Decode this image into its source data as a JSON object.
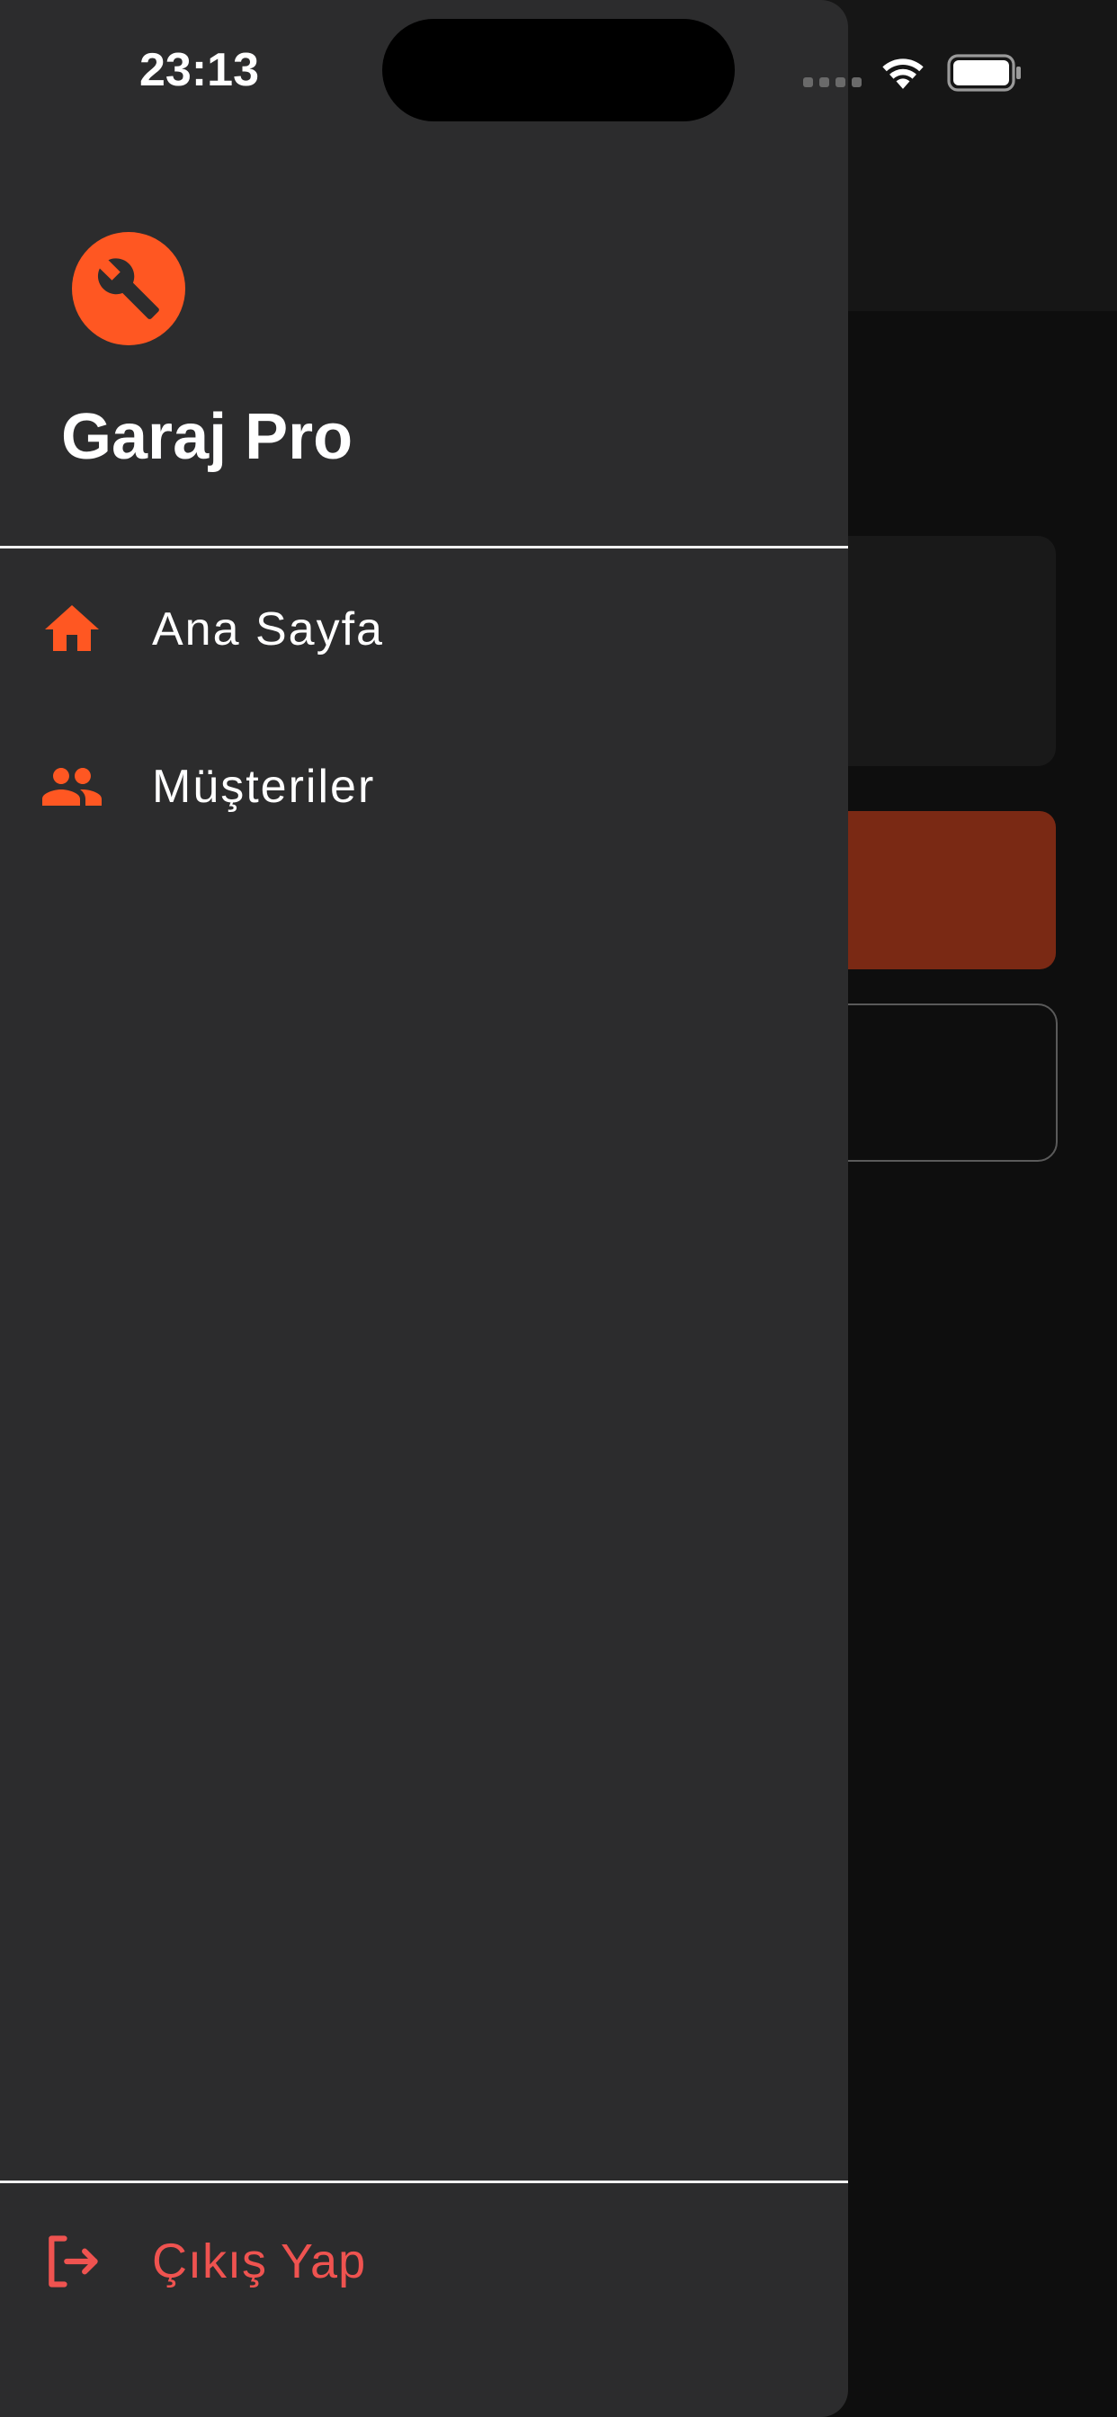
{
  "status_bar": {
    "time": "23:13"
  },
  "drawer": {
    "app_title": "Garaj Pro",
    "logo_icon": "wrench-icon",
    "menu": [
      {
        "label": "Ana Sayfa",
        "icon": "home-icon"
      },
      {
        "label": "Müşteriler",
        "icon": "people-icon"
      }
    ],
    "logout": {
      "label": "Çıkış Yap",
      "icon": "logout-icon"
    }
  },
  "colors": {
    "accent": "#ff5722",
    "drawer_bg": "#2c2c2d",
    "logout_text": "#ef5350",
    "background": "#0e0e0e"
  }
}
